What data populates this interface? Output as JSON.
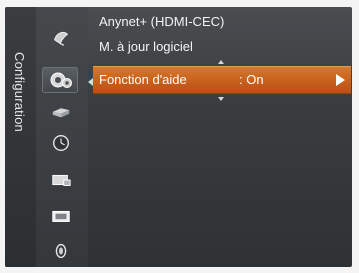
{
  "side_label": "Configuration",
  "menu": {
    "items": [
      {
        "label": "Anynet+ (HDMI-CEC)"
      },
      {
        "label": "M. à jour logiciel"
      }
    ],
    "selected": {
      "label": "Fonction d'aide",
      "value": ": On"
    }
  },
  "icons": [
    "satellite-dish-icon",
    "settings-icon",
    "input-icon",
    "clock-icon",
    "channel-icon",
    "picture-icon",
    "sound-icon"
  ],
  "colors": {
    "highlight": "#c9601e",
    "panel": "#3a3d40",
    "text": "#f3f3f3"
  }
}
